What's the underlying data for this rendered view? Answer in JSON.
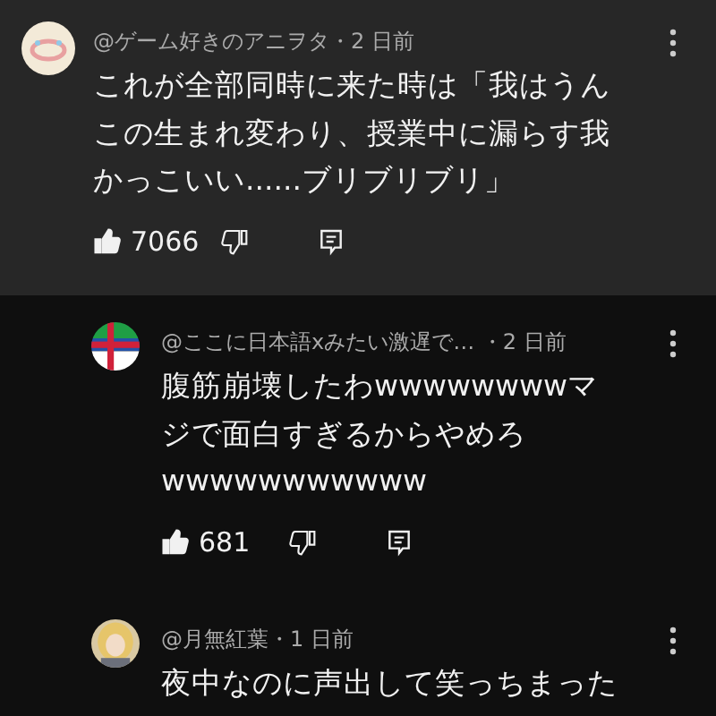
{
  "comments": [
    {
      "kind": "top",
      "highlighted": true,
      "meta": "@ゲーム好きのアニヲタ・2 日前",
      "lines": [
        "これが全部同時に来た時は「我はうん",
        "この生まれ変わり、授業中に漏らす我",
        "かっこいい......ブリブリブリ」"
      ],
      "likes": "7066",
      "liked": true
    },
    {
      "kind": "reply",
      "meta": "@ここに日本語xみたい激遅で…  ・2 日前",
      "lines": [
        "腹筋崩壊したわwwwwwwwwマ",
        "ジで面白すぎるからやめろ",
        "wwwwwwwwwww"
      ],
      "likes": "681",
      "liked": true
    },
    {
      "kind": "reply",
      "meta": "@月無紅葉・1 日前",
      "lines": [
        "夜中なのに声出して笑っちまった"
      ]
    }
  ]
}
